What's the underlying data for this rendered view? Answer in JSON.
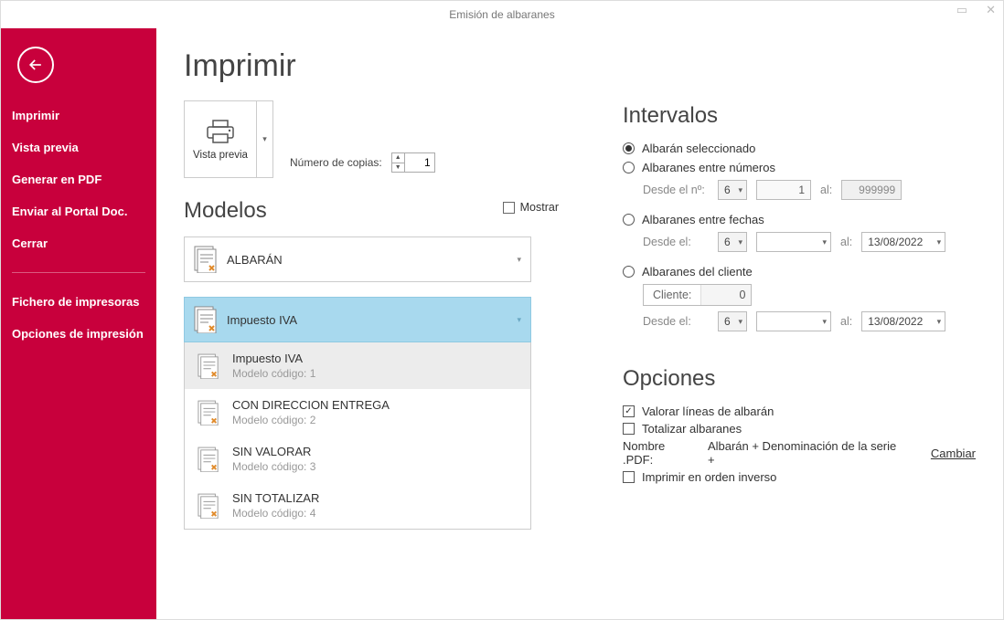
{
  "window": {
    "title": "Emisión de albaranes"
  },
  "sidebar": {
    "items": [
      "Imprimir",
      "Vista previa",
      "Generar en PDF",
      "Enviar al Portal Doc.",
      "Cerrar"
    ],
    "items2": [
      "Fichero de impresoras",
      "Opciones de impresión"
    ]
  },
  "page": {
    "title": "Imprimir"
  },
  "preview": {
    "label": "Vista previa",
    "copies_label": "Número de copias:",
    "copies": "1"
  },
  "modelos": {
    "heading": "Modelos",
    "mostrar": "Mostrar",
    "selected": "ALBARÁN",
    "group": "Impuesto IVA",
    "list": [
      {
        "name": "Impuesto IVA",
        "code": "Modelo código: 1"
      },
      {
        "name": "CON DIRECCION ENTREGA",
        "code": "Modelo código: 2"
      },
      {
        "name": "SIN VALORAR",
        "code": "Modelo código: 3"
      },
      {
        "name": "SIN TOTALIZAR",
        "code": "Modelo código: 4"
      }
    ]
  },
  "intervalos": {
    "heading": "Intervalos",
    "r1": "Albarán seleccionado",
    "r2": "Albaranes entre números",
    "r2_from": "Desde el nº:",
    "r2_series": "6",
    "r2_from_v": "1",
    "r2_al": "al:",
    "r2_to": "999999",
    "r3": "Albaranes entre fechas",
    "r3_from": "Desde el:",
    "r3_series": "6",
    "r3_al": "al:",
    "r3_to": "13/08/2022",
    "r4": "Albaranes del cliente",
    "r4_cliente_l": "Cliente:",
    "r4_cliente_v": "0",
    "r4_from": "Desde el:",
    "r4_series": "6",
    "r4_al": "al:",
    "r4_to": "13/08/2022"
  },
  "opciones": {
    "heading": "Opciones",
    "o1": "Valorar líneas de albarán",
    "o2": "Totalizar albaranes",
    "pdf_l": "Nombre .PDF:",
    "pdf_v": "Albarán + Denominación de la serie +",
    "cambiar": "Cambiar",
    "o3": "Imprimir en orden inverso"
  }
}
